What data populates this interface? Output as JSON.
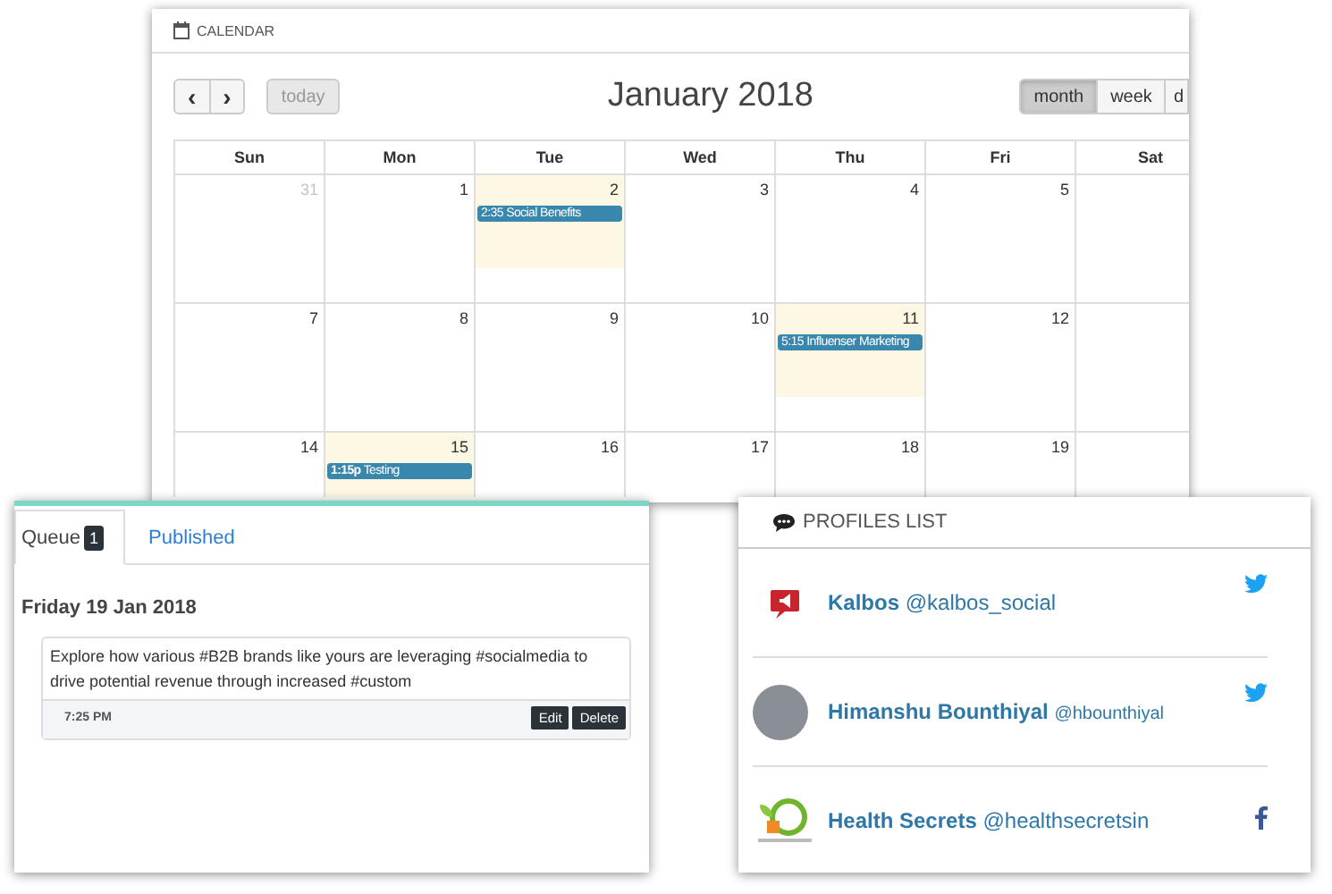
{
  "calendar": {
    "header": "CALENDAR",
    "title": "January 2018",
    "nav": [
      "‹",
      "›"
    ],
    "today": "today",
    "views": [
      {
        "label": "month",
        "selected": true
      },
      {
        "label": "week",
        "selected": false
      },
      {
        "label": "d",
        "selected": false
      }
    ],
    "weekdays": [
      "Sun",
      "Mon",
      "Tue",
      "Wed",
      "Thu",
      "Fri",
      "Sat"
    ],
    "weeks": [
      [
        {
          "day": "31",
          "other_month": true,
          "highlight": false
        },
        {
          "day": "1",
          "other_month": false,
          "highlight": false
        },
        {
          "day": "2",
          "other_month": false,
          "highlight": true,
          "events": [
            {
              "time": "2:35",
              "title": "Social Benefits",
              "time_bold": false
            }
          ]
        },
        {
          "day": "3",
          "other_month": false,
          "highlight": false
        },
        {
          "day": "4",
          "other_month": false,
          "highlight": false
        },
        {
          "day": "5",
          "other_month": false,
          "highlight": false
        }
      ],
      [
        {
          "day": "7",
          "other_month": false,
          "highlight": false
        },
        {
          "day": "8",
          "other_month": false,
          "highlight": false
        },
        {
          "day": "9",
          "other_month": false,
          "highlight": false
        },
        {
          "day": "10",
          "other_month": false,
          "highlight": false
        },
        {
          "day": "11",
          "other_month": false,
          "highlight": true,
          "events": [
            {
              "time": "5:15",
              "title": "Influenser Marketing",
              "time_bold": false
            }
          ]
        },
        {
          "day": "12",
          "other_month": false,
          "highlight": false
        }
      ],
      [
        {
          "day": "14",
          "other_month": false,
          "highlight": false
        },
        {
          "day": "15",
          "other_month": false,
          "highlight": true,
          "events": [
            {
              "time": "1:15p",
              "title": "Testing",
              "time_bold": true
            }
          ]
        },
        {
          "day": "16",
          "other_month": false,
          "highlight": false
        },
        {
          "day": "17",
          "other_month": false,
          "highlight": false
        },
        {
          "day": "18",
          "other_month": false,
          "highlight": false
        },
        {
          "day": "19",
          "other_month": false,
          "highlight": false
        }
      ]
    ]
  },
  "queue": {
    "tabs": [
      {
        "label": "Queue",
        "badge": "1",
        "selected": true
      },
      {
        "label": "Published",
        "selected": false
      }
    ],
    "date": "Friday 19 Jan 2018",
    "post": {
      "text": "Explore how various #B2B brands like yours are leveraging #socialmedia to drive potential revenue through increased #custom",
      "time": "7:25 PM",
      "actions": [
        "Edit",
        "Delete"
      ]
    }
  },
  "profiles": {
    "header": "PROFILES LIST",
    "items": [
      {
        "name": "Kalbos",
        "handle": "@kalbos_social",
        "avatar": {
          "kind": "icon"
        },
        "network": {
          "kind": "twitter"
        }
      },
      {
        "name": "Himanshu Bounthiyal",
        "handle": "@hbounthiyal",
        "avatar": {
          "kind": "photo"
        },
        "network": {
          "kind": "twitter"
        }
      },
      {
        "name": "Health Secrets",
        "handle": "@healthsecretsin",
        "avatar": {
          "kind": "badge"
        },
        "network": {
          "kind": "facebook"
        }
      }
    ]
  }
}
